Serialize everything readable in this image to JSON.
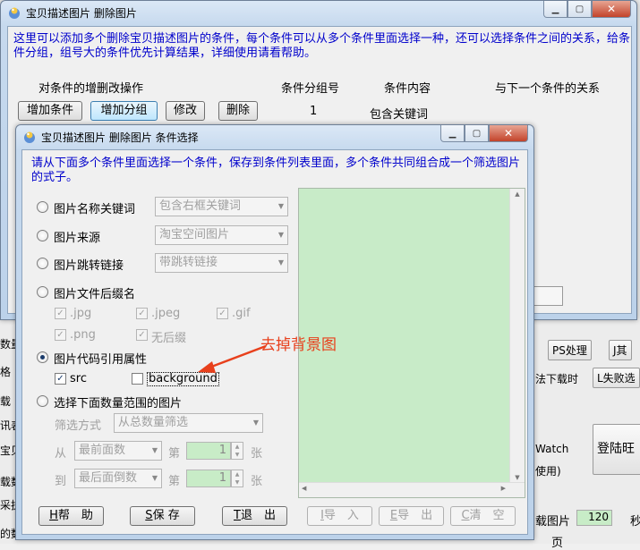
{
  "background_app": {
    "fragments": [
      "数量",
      "格",
      "载",
      "讯表",
      "宝贝",
      "载数",
      "采执",
      "的数"
    ],
    "buttons": [
      "PS处理",
      "J其",
      "法下载时",
      "L失败选",
      "登陆旺"
    ],
    "right_texts": [
      "Watch",
      "使用)",
      "载图片",
      "秒",
      "页"
    ],
    "right_number": "120"
  },
  "main_window": {
    "title": "宝贝描述图片 删除图片",
    "description": "这里可以添加多个删除宝贝描述图片的条件，每个条件可以从多个条件里面选择一种，还可以选择条件之间的关系，给条件分组，组号大的条件优先计算结果，详细使用请看帮助。",
    "headers": [
      "对条件的增删改操作",
      "条件分组号",
      "条件内容",
      "与下一个条件的关系"
    ],
    "buttons": [
      "增加条件",
      "增加分组",
      "修改",
      "删除"
    ],
    "row": {
      "group": "1",
      "content": "包含关键词"
    }
  },
  "dialog": {
    "title": "宝贝描述图片 删除图片 条件选择",
    "instruction": "请从下面多个条件里面选择一个条件，保存到条件列表里面，多个条件共同组合成一个筛选图片的式子。",
    "options": [
      {
        "label": "图片名称关键词",
        "combo": "包含右框关键词",
        "selected": false
      },
      {
        "label": "图片来源",
        "combo": "淘宝空间图片",
        "selected": false
      },
      {
        "label": "图片跳转链接",
        "combo": "带跳转链接",
        "selected": false
      },
      {
        "label": "图片文件后缀名",
        "selected": false
      },
      {
        "label": "图片代码引用属性",
        "selected": true
      },
      {
        "label": "选择下面数量范围的图片",
        "selected": false
      }
    ],
    "suffixes": [
      ".jpg",
      ".jpeg",
      ".gif",
      ".png",
      "无后缀"
    ],
    "attrs": [
      {
        "label": "src",
        "checked": true
      },
      {
        "label": "background",
        "checked": false
      }
    ],
    "filter_label": "筛选方式",
    "filter_value": "从总数量筛选",
    "from_label": "从",
    "from_combo": "最前面数",
    "to_label": "到",
    "to_combo": "最后面倒数",
    "nth_label": "第",
    "unit_label": "张",
    "from_value": "1",
    "to_value": "1",
    "buttons": {
      "help_key": "H",
      "help_text": "帮　助",
      "save_key": "S",
      "save_text": "保 存",
      "exit_key": "T",
      "exit_text": "退　出",
      "import_key": "I",
      "import_text": "导　入",
      "export_key": "E",
      "export_text": "导　出",
      "clear_key": "C",
      "clear_text": "清　空"
    }
  },
  "annotation": "去掉背景图",
  "colors": {
    "accent_text": "#0000cc",
    "annotation": "#e8401c",
    "green_panel": "#c8ebc8",
    "green_input": "#c8ecc7"
  }
}
